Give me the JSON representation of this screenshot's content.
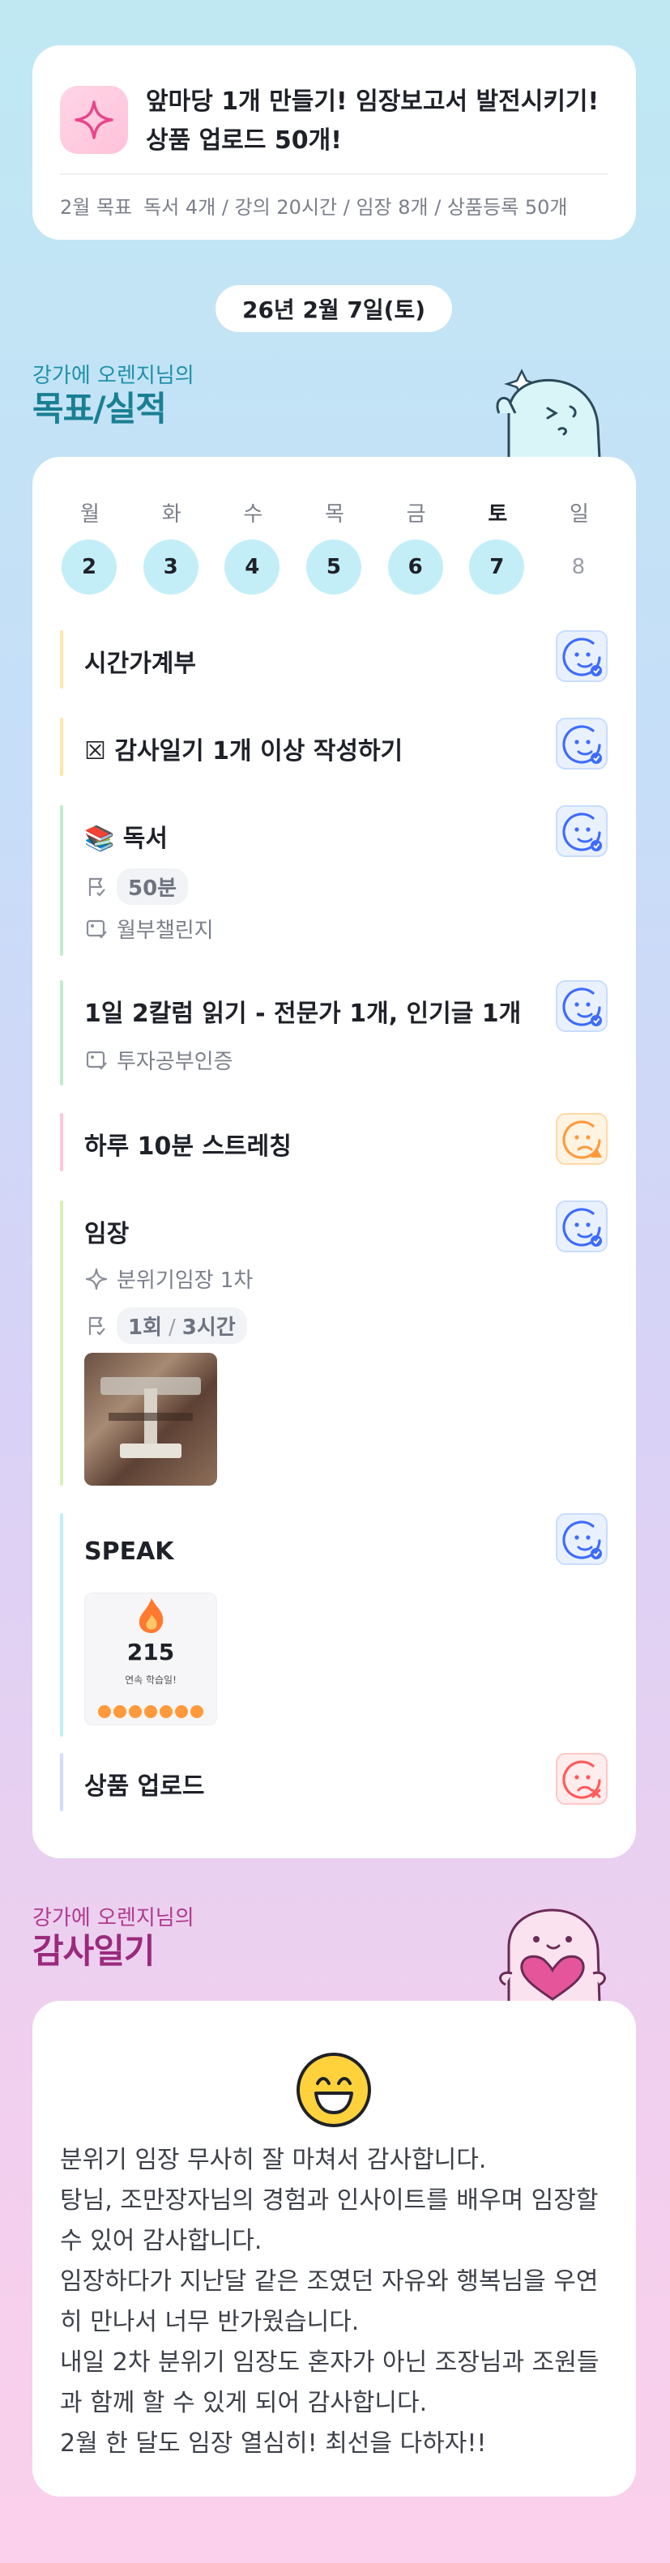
{
  "goal": {
    "title": "앞마당 1개 만들기! 임장보고서 발전시키기! 상품 업로드 50개!",
    "summary_label": "2월 목표",
    "summary_items": "독서 4개 / 강의 20시간 / 임장 8개 / 상품등록 50개"
  },
  "date": "26년 2월 7일(토)",
  "performance_section": {
    "subtitle": "강가에 오렌지님의",
    "title": "목표/실적"
  },
  "week": [
    {
      "name": "월",
      "num": "2",
      "active": true
    },
    {
      "name": "화",
      "num": "3",
      "active": true
    },
    {
      "name": "수",
      "num": "4",
      "active": true
    },
    {
      "name": "목",
      "num": "5",
      "active": true
    },
    {
      "name": "금",
      "num": "6",
      "active": true
    },
    {
      "name": "토",
      "num": "7",
      "active": true,
      "today": true
    },
    {
      "name": "일",
      "num": "8",
      "active": false
    }
  ],
  "tasks": [
    {
      "title": "시간가계부",
      "status": "done"
    },
    {
      "title": "☒ 감사일기 1개 이상 작성하기",
      "status": "done"
    },
    {
      "title": "📚 독서",
      "status": "done",
      "goal_value": "50분",
      "challenge": "월부챌린지"
    },
    {
      "title": "1일 2칼럼 읽기 - 전문가 1개, 인기글 1개",
      "status": "done",
      "challenge": "투자공부인증"
    },
    {
      "title": "하루 10분 스트레칭",
      "status": "warning"
    },
    {
      "title": "임장",
      "status": "done",
      "mission": "분위기임장 1차",
      "count": "1회",
      "hours": "3시간"
    },
    {
      "title": "SPEAK",
      "status": "done",
      "streak": "215",
      "streak_label": "연속 학습일!"
    },
    {
      "title": "상품 업로드",
      "status": "failed"
    }
  ],
  "gratitude_section": {
    "subtitle": "강가에 오렌지님의",
    "title": "감사일기"
  },
  "gratitude": {
    "text": "분위기 임장 무사히 잘 마쳐서 감사합니다.\n탕님, 조만장자님의 경험과 인사이트를 배우며 임장할 수 있어 감사합니다.\n임장하다가 지난달 같은 조였던 자유와 행복님을 우연히 만나서 너무 반가웠습니다.\n내일 2차 분위기 임장도 혼자가 아닌 조장님과 조원들과 함께 할 수 있게 되어 감사합니다.\n2월 한 달도 임장 열심히! 최선을 다하자!!"
  },
  "colors": {
    "teal_heading": "#1a7f93",
    "magenta_heading": "#9a2a7d",
    "day_circle": "#c3eef7",
    "status_done": "#3d6bff",
    "status_warn": "#ff9a3c",
    "status_fail": "#ff5a5a"
  },
  "icons": {
    "goal": "sparkle-icon",
    "done": "smile-check-icon",
    "warning": "face-warning-icon",
    "failed": "face-x-icon",
    "goal_flag": "flag-icon",
    "challenge": "image-check-icon",
    "mission": "sparkle-outline-icon"
  }
}
